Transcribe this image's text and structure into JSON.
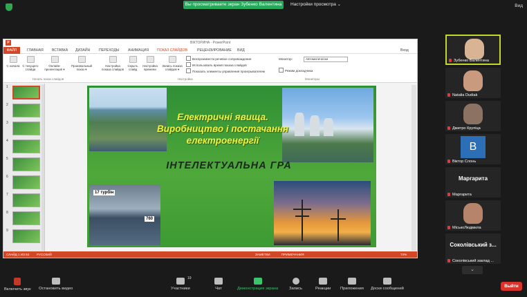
{
  "zoom": {
    "share_banner": "Вы просматриваете экран Зубенко Валентина",
    "view_options": "Настройки просмотра ⌄",
    "view_label": "Вид"
  },
  "ppt": {
    "window_title": "ВІКТОРИНА - PowerPoint",
    "logo": "P",
    "tabs": [
      "ФАЙЛ",
      "ГЛАВНАЯ",
      "ВСТАВКА",
      "ДИЗАЙН",
      "ПЕРЕХОДЫ",
      "АНИМАЦИЯ",
      "ПОКАЗ СЛАЙДОВ",
      "РЕЦЕНЗИРОВАНИЕ",
      "ВИД"
    ],
    "signin": "Вход",
    "ribbon": {
      "btn_from_start": "С начала",
      "btn_from_current": "С текущего слайда",
      "btn_online": "Онлайн-презентация ▾",
      "btn_custom": "Произвольный показ ▾",
      "btn_setup": "Настройка показа слайдов",
      "btn_hide": "Скрыть слайд",
      "btn_timing": "Настройка времени",
      "btn_record": "Запись показа слайдов ▾",
      "chk_narration": "Воспроизвести речевое сопровождение",
      "chk_timings": "Использовать время показа слайдов",
      "chk_controls": "Показать элементы управления проигрывателем",
      "monitor_label": "Монитор:",
      "monitor_value": "Автоматически",
      "chk_presenter": "Режим докладчика",
      "group_start": "Начать показ слайдов",
      "group_setup": "Настройка",
      "group_monitors": "Мониторы"
    },
    "thumb_numbers": [
      "1",
      "2",
      "3",
      "4",
      "5",
      "6",
      "7",
      "8",
      "9"
    ],
    "slide": {
      "title_line1": "Електричні явища.",
      "title_line2": "Виробництво і постачання",
      "title_line3": "електроенергії",
      "subtitle": "ІНТЕЛЕКТУАЛЬНА ГРА",
      "badge_turbines": "17 турбін",
      "badge_760": "760"
    },
    "status": {
      "slide_info": "СЛАЙД 1 ИЗ 53",
      "language": "РУССКИЙ",
      "notes": "ЗАМЕТКИ",
      "comments": "ПРИМЕЧАНИЯ",
      "zoom": "74%"
    }
  },
  "participants": [
    {
      "name": "Зубенко Валентина"
    },
    {
      "name": "Natalia Dudiak"
    },
    {
      "name": "Дмитро Крупіца"
    },
    {
      "name": "Віктор Слонь",
      "avatar_letter": "В"
    },
    {
      "name": "Маргарита",
      "big": "Маргарита"
    },
    {
      "name": "МіськоЛюдмила"
    },
    {
      "name": "Соколівський заклад ...",
      "big": "Соколівський з..."
    }
  ],
  "more_label": "⌄",
  "toolbar": {
    "mic": "Включить звук",
    "video": "Остановить видео",
    "participants": "Участники",
    "participants_count": "19",
    "chat": "Чат",
    "share": "Демонстрация экрана",
    "record": "Запись",
    "reactions": "Реакции",
    "apps": "Приложения",
    "whiteboard": "Доски сообщений",
    "leave": "Выйти"
  },
  "colors": {
    "zoom_green": "#26a85a",
    "ppt_accent": "#d24726",
    "leave_red": "#d8342c",
    "active_speaker": "#c3d92b"
  }
}
